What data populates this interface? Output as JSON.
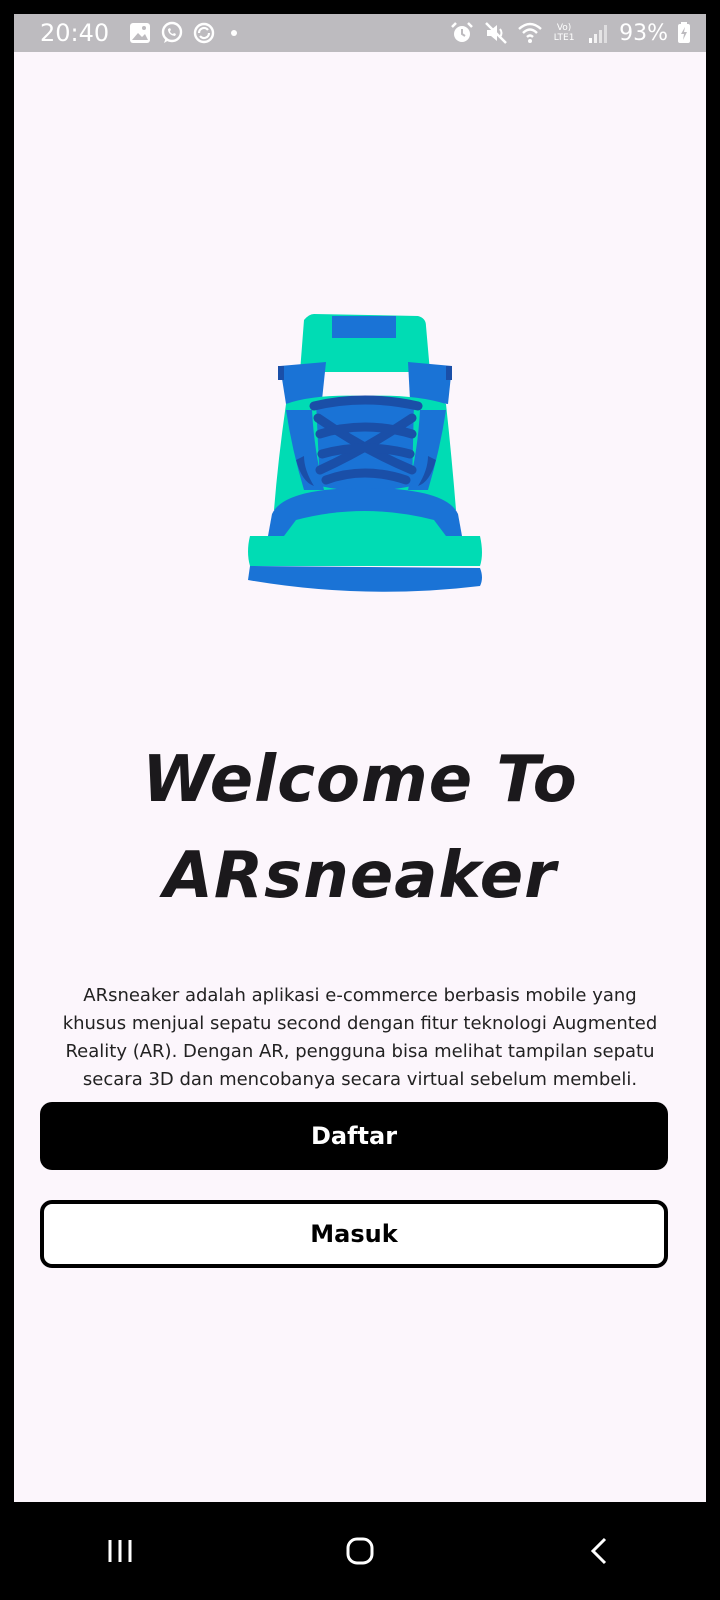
{
  "status_bar": {
    "time": "20:40",
    "battery": "93%",
    "network_label": "Vo) LTE1",
    "icons_left": [
      "gallery-icon",
      "whatsapp-icon",
      "sync-icon",
      "notification-dot"
    ],
    "icons_right": [
      "alarm-icon",
      "mute-icon",
      "wifi-icon",
      "lte-icon",
      "signal-icon",
      "battery-charging-icon"
    ]
  },
  "welcome": {
    "title_line1": "Welcome To",
    "title_line2": "ARsneaker",
    "description": "ARsneaker adalah aplikasi e-commerce berbasis mobile yang khusus menjual sepatu second dengan fitur teknologi Augmented Reality (AR). Dengan AR, pengguna bisa melihat tampilan sepatu secara 3D dan mencobanya secara virtual sebelum membeli."
  },
  "buttons": {
    "register_label": "Daftar",
    "login_label": "Masuk"
  },
  "colors": {
    "background": "#fcf6fc",
    "sneaker_teal": "#00dcb4",
    "sneaker_blue": "#1a73d6",
    "sneaker_lace": "#1a4fa8",
    "primary_button": "#000000",
    "status_bar": "#bdbbbf"
  },
  "nav_bar": {
    "icons": [
      "recent-apps-icon",
      "home-icon",
      "back-icon"
    ]
  }
}
